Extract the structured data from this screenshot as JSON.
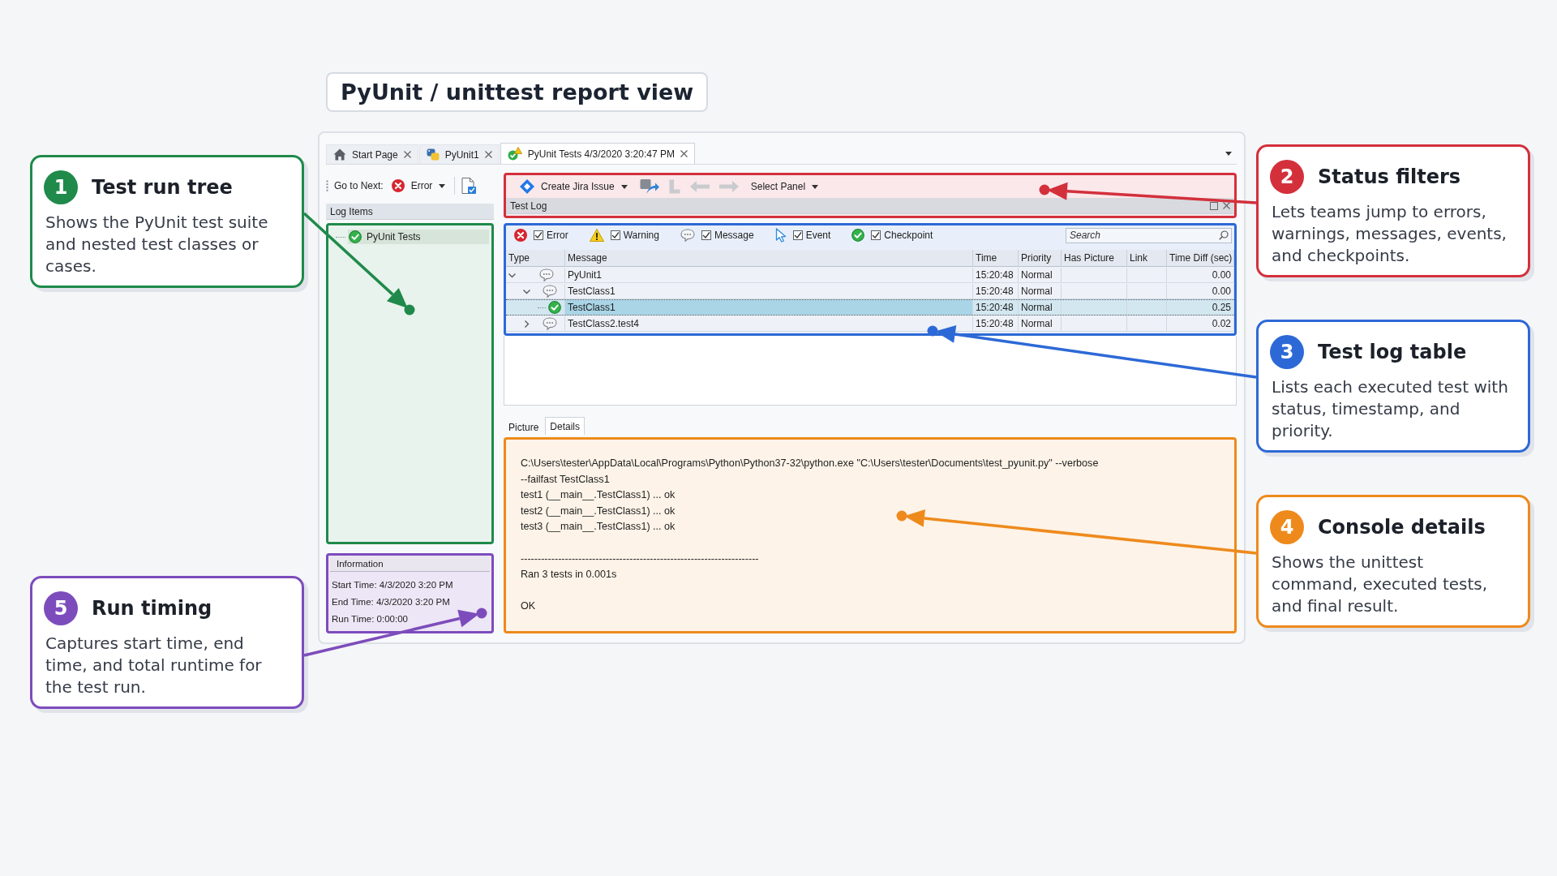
{
  "title": "PyUnit / unittest report view",
  "app": {
    "tabs": [
      {
        "kind": "start_page",
        "label": "Start Page",
        "selected": false
      },
      {
        "kind": "project",
        "label": "PyUnit1",
        "selected": false
      },
      {
        "kind": "log",
        "label": "PyUnit Tests 4/3/2020 3:20:47 PM",
        "selected": true
      }
    ],
    "toolbar": {
      "go_to_next": "Go to Next:",
      "next_filter": "Error",
      "create_issue": "Create Jira Issue",
      "tools": [
        {
          "kind": "transfer",
          "disabled": false
        },
        {
          "kind": "up",
          "disabled": true
        },
        {
          "kind": "back",
          "disabled": true
        },
        {
          "kind": "forward",
          "disabled": true
        }
      ],
      "select_panel": "Select Panel"
    },
    "log_items": {
      "title": "Log Items",
      "items": [
        {
          "label": "PyUnit Tests",
          "selected": true
        }
      ]
    },
    "information": {
      "title": "Information",
      "lines": [
        "Start Time: 4/3/2020 3:20 PM",
        "End Time: 4/3/2020 3:20 PM",
        "Run Time: 0:00:00"
      ]
    },
    "test_log": {
      "title": "Test Log",
      "filters": [
        {
          "kind": "error",
          "label": "Error",
          "checked": true
        },
        {
          "kind": "warning",
          "label": "Warning",
          "checked": true
        },
        {
          "kind": "message",
          "label": "Message",
          "checked": true
        },
        {
          "kind": "event",
          "label": "Event",
          "checked": true
        },
        {
          "kind": "checkpoint",
          "label": "Checkpoint",
          "checked": true
        }
      ],
      "search": {
        "placeholder": "Search"
      },
      "columns": [
        "Type",
        "Message",
        "Time",
        "Priority",
        "Has Picture",
        "Link",
        "Time Diff (sec)"
      ],
      "rows": [
        {
          "kind": "message",
          "message": "PyUnit1",
          "time": "15:20:48",
          "priority": "Normal",
          "time_diff": "0.00",
          "expanded": true,
          "selected": false,
          "children": [
            {
              "kind": "message",
              "message": "TestClass1",
              "time": "15:20:48",
              "priority": "Normal",
              "time_diff": "0.00",
              "expanded": true,
              "selected": false,
              "children": [
                {
                  "kind": "checkpoint",
                  "message": "TestClass1",
                  "time": "15:20:48",
                  "priority": "Normal",
                  "time_diff": "0.25",
                  "selected": true
                }
              ]
            },
            {
              "kind": "message",
              "message": "TestClass2.test4",
              "time": "15:20:48",
              "priority": "Normal",
              "time_diff": "0.02",
              "expanded": false,
              "selected": false
            }
          ]
        }
      ]
    },
    "detail_tabs": [
      {
        "label": "Picture",
        "selected": false
      },
      {
        "label": "Details",
        "selected": true
      }
    ],
    "console": [
      [
        "C:\\Users\\tester\\AppData\\Local\\Programs\\Python\\Python37-32\\python.exe \"C:\\Users\\tester\\Documents\\test_pyunit.py\" --verbose",
        "--failfast TestClass1",
        "test1 (__main__.TestClass1) ... ok",
        "test2 (__main__.TestClass1) ... ok",
        "test3 (__main__.TestClass1) ... ok"
      ],
      [
        "----------------------------------------------------------------------",
        "Ran 3 tests in 0.001s"
      ],
      [
        "OK"
      ]
    ]
  },
  "callouts": [
    {
      "number": "1",
      "title": "Test run tree",
      "text": "Shows the PyUnit test suite and nested test classes or cases.",
      "color": "#1f8a4a"
    },
    {
      "number": "2",
      "title": "Status filters",
      "text": "Lets teams jump to errors, warnings, messages, events, and checkpoints.",
      "color": "#d3303c"
    },
    {
      "number": "3",
      "title": "Test log table",
      "text": "Lists each executed test with status, timestamp, and priority.",
      "color": "#2d69d6"
    },
    {
      "number": "4",
      "title": "Console details",
      "text": "Shows the unittest command, executed tests, and final result.",
      "color": "#ee8a1c"
    },
    {
      "number": "5",
      "title": "Run timing",
      "text": "Captures start time, end time, and total runtime for the test run.",
      "color": "#7d4cbc"
    }
  ]
}
